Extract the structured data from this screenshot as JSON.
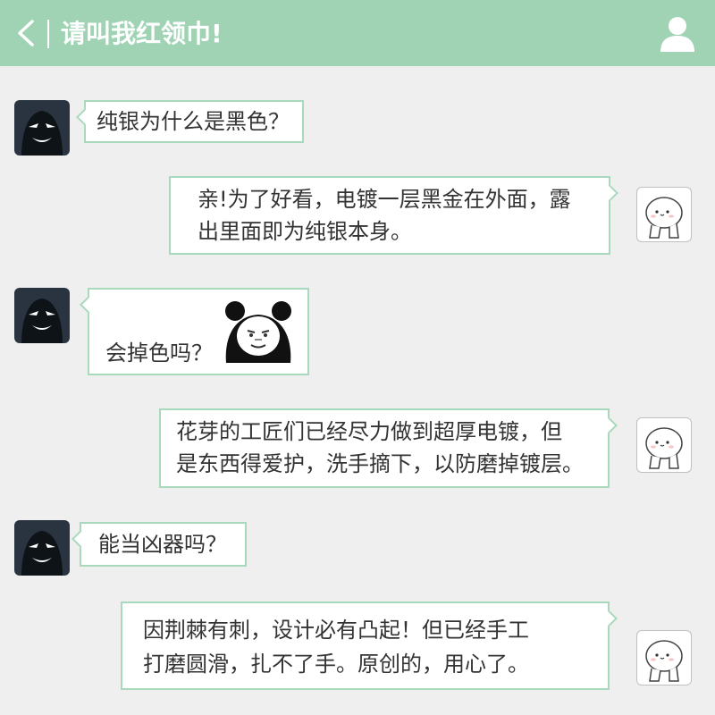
{
  "header": {
    "back_icon": "chevron-left-icon",
    "title": "请叫我红领巾!",
    "profile_icon": "person-icon",
    "background": "#9fd3b4"
  },
  "messages": [
    {
      "side": "left",
      "text": "纯银为什么是黑色？"
    },
    {
      "side": "right",
      "lines": [
        "亲!为了好看，电镀一层黑金在外面，露",
        "出里面即为纯银本身。"
      ]
    },
    {
      "side": "left",
      "text": "会掉色吗？",
      "sticker": "panda-meme-sticker"
    },
    {
      "side": "right",
      "lines": [
        "花芽的工匠们已经尽力做到超厚电镀，但",
        "是东西得爱护，洗手摘下，以防磨掉镀层。"
      ]
    },
    {
      "side": "left",
      "text": "能当凶器吗？"
    },
    {
      "side": "right",
      "lines": [
        "因荆棘有刺，设计必有凸起！但已经手工",
        "打磨圆滑，扎不了手。原创的，用心了。"
      ]
    }
  ],
  "colors": {
    "bubble_border": "#a8d9bd",
    "page_background": "#efefef"
  }
}
